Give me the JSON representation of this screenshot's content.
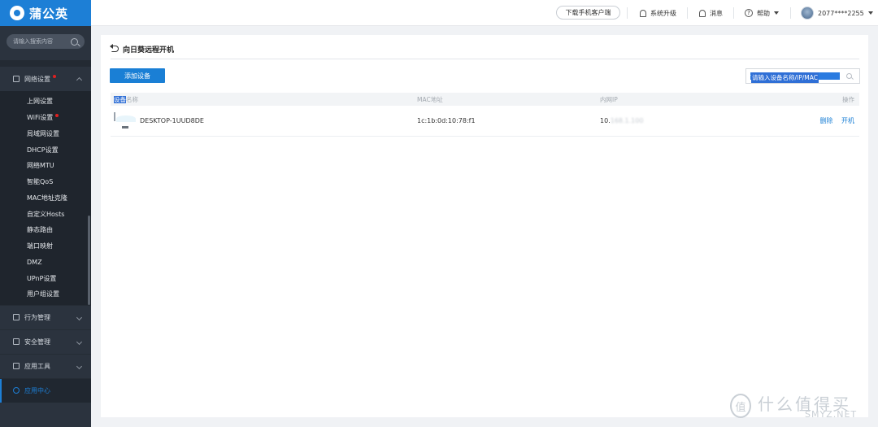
{
  "brand": {
    "name": "蒲公英"
  },
  "sidebar": {
    "search_placeholder": "请输入搜索内容",
    "network_group": {
      "label": "网络设置"
    },
    "sub_items": [
      {
        "label": "上网设置",
        "dot": false
      },
      {
        "label": "WiFi设置",
        "dot": true
      },
      {
        "label": "局域网设置",
        "dot": false
      },
      {
        "label": "DHCP设置",
        "dot": false
      },
      {
        "label": "网络MTU",
        "dot": false
      },
      {
        "label": "智能QoS",
        "dot": false
      },
      {
        "label": "MAC地址克隆",
        "dot": false
      },
      {
        "label": "自定义Hosts",
        "dot": false
      },
      {
        "label": "静态路由",
        "dot": false
      },
      {
        "label": "端口映射",
        "dot": false
      },
      {
        "label": "DMZ",
        "dot": false
      },
      {
        "label": "UPnP设置",
        "dot": false
      },
      {
        "label": "用户组设置",
        "dot": false
      }
    ],
    "groups": [
      {
        "label": "行为管理"
      },
      {
        "label": "安全管理"
      },
      {
        "label": "应用工具"
      },
      {
        "label": "应用中心"
      }
    ]
  },
  "header": {
    "download_label": "下载手机客户端",
    "upgrade_label": "系统升级",
    "messages_label": "消息",
    "help_label": "帮助",
    "user_label": "2077****2255"
  },
  "page": {
    "title": "向日葵远程开机",
    "add_button": "添加设备",
    "search_placeholder": "请输入设备名称/IP/MAC",
    "columns": {
      "name_hl": "设备",
      "name_rest": "名称",
      "mac": "MAC地址",
      "ip": "内网IP",
      "actions": "操作"
    },
    "rows": [
      {
        "name": "DESKTOP-1UUD8DE",
        "mac": "1c:1b:0d:10:78:f1",
        "ip_prefix": "10.",
        "ip_hidden": "168.1.100",
        "delete_label": "删除",
        "wake_label": "开机"
      }
    ]
  },
  "watermark": {
    "icon_char": "值",
    "text": "什么值得买",
    "sub": "SMYZ.NET"
  }
}
